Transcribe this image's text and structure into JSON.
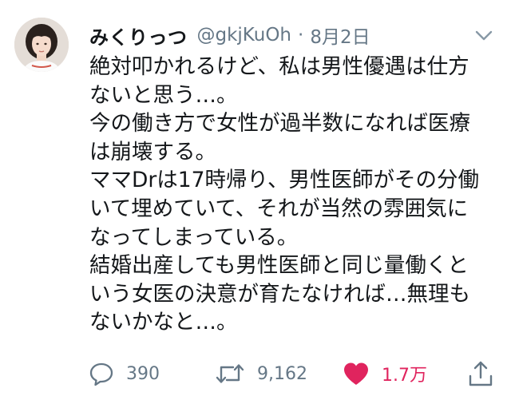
{
  "author": {
    "display_name": "みくりっつ",
    "handle": "@gkjKuOh",
    "separator": "·",
    "date": "8月2日"
  },
  "tweet": {
    "lines": [
      "絶対叩かれるけど、私は男性優遇は仕方",
      "ないと思う…。",
      "今の働き方で女性が過半数になれば医療",
      "は崩壊する。",
      "ママDrは17時帰り、男性医師がその分働",
      "いて埋めていて、それが当然の雰囲気に",
      "なってしまっている。",
      "結婚出産しても男性医師と同じ量働くと",
      "いう女医の決意が育たなければ…無理も",
      "ないかなと…。"
    ]
  },
  "actions": {
    "reply_count": "390",
    "retweet_count": "9,162",
    "like_count": "1.7万",
    "like_active": true
  },
  "icons": {
    "menu": "chevron-down-icon",
    "reply": "speech-bubble-icon",
    "retweet": "retweet-arrows-icon",
    "like": "heart-icon",
    "share": "share-upload-icon"
  },
  "colors": {
    "text": "#14171a",
    "secondary": "#657786",
    "like": "#e0245e"
  }
}
